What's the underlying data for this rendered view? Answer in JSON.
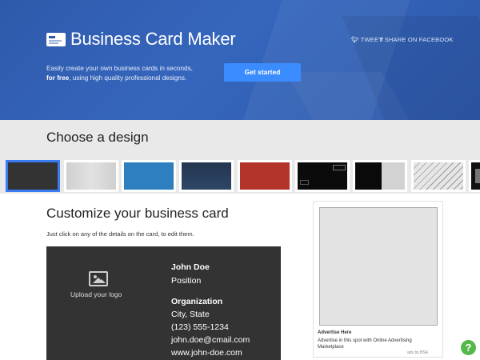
{
  "header": {
    "brand": "Business Card Maker",
    "tweet": "TWEET",
    "share": "SHARE ON FACEBOOK",
    "tagline_line1": "Easily create your own business cards in seconds,",
    "tagline_bold": "for free",
    "tagline_line2_rest": ", using high quality professional designs.",
    "cta": "Get started"
  },
  "designs": {
    "title": "Choose a design",
    "thumbnails": [
      {
        "name": "dark-charcoal",
        "selected": true
      },
      {
        "name": "light-gray",
        "selected": false
      },
      {
        "name": "blue",
        "selected": false
      },
      {
        "name": "navy",
        "selected": false
      },
      {
        "name": "red",
        "selected": false
      },
      {
        "name": "black-outlined",
        "selected": false
      },
      {
        "name": "black-gray-split",
        "selected": false
      },
      {
        "name": "diagonal-stripes",
        "selected": false
      },
      {
        "name": "black-partial",
        "selected": false
      }
    ]
  },
  "customize": {
    "title": "Customize your business card",
    "subtitle": "Just click on any of the details on the card, to edit them.",
    "upload_logo": "Upload your logo",
    "name": "John Doe",
    "position": "Position",
    "organization": "Organization",
    "city_state": "City, State",
    "phone": "(123) 555-1234",
    "email": "john.doe@cmail.com",
    "website": "www.john-doe.com"
  },
  "ad": {
    "heading": "Advertise Here",
    "text": "Advertise in this spot with Online Advertising Marketplace",
    "by": "ads by BSA"
  },
  "help": {
    "label": "?"
  },
  "colors": {
    "hero": "#2f5aab",
    "cta": "#3b8cff",
    "selected_border": "#3b7cf2",
    "card": "#333333",
    "help": "#55b84a"
  }
}
